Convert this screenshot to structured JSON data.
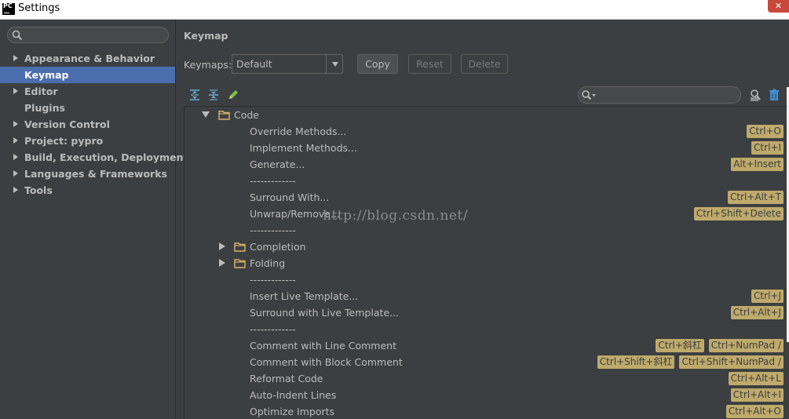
{
  "window": {
    "title": "Settings",
    "app_icon_text": "PC",
    "close_glyph": "✕"
  },
  "sidebar": {
    "search": {
      "placeholder": "",
      "value": ""
    },
    "items": [
      {
        "label": "Appearance & Behavior",
        "expandable": true
      },
      {
        "label": "Keymap",
        "expandable": false,
        "selected": true
      },
      {
        "label": "Editor",
        "expandable": true
      },
      {
        "label": "Plugins",
        "expandable": false
      },
      {
        "label": "Version Control",
        "expandable": true
      },
      {
        "label": "Project: pypro",
        "expandable": true
      },
      {
        "label": "Build, Execution, Deployment",
        "expandable": true
      },
      {
        "label": "Languages & Frameworks",
        "expandable": true
      },
      {
        "label": "Tools",
        "expandable": true
      }
    ]
  },
  "main": {
    "title": "Keymap",
    "keymaps_label": "Keymaps:",
    "keymap_selected": "Default",
    "buttons": {
      "copy": "Copy",
      "reset": "Reset",
      "delete": "Delete"
    },
    "toolbar_icons": [
      "expand-all-icon",
      "collapse-all-icon",
      "edit-icon"
    ],
    "filter": {
      "placeholder": "",
      "value": ""
    },
    "right_icons": [
      "find-by-shortcut-icon",
      "clear-filter-icon"
    ]
  },
  "tree": {
    "root": {
      "label": "Code",
      "expanded": true
    },
    "rows": [
      {
        "label": "Override Methods...",
        "shortcuts": [
          "Ctrl+O"
        ]
      },
      {
        "label": "Implement Methods...",
        "shortcuts": [
          "Ctrl+I"
        ]
      },
      {
        "label": "Generate...",
        "shortcuts": [
          "Alt+Insert"
        ]
      },
      {
        "label": "-------------",
        "shortcuts": []
      },
      {
        "label": "Surround With...",
        "shortcuts": [
          "Ctrl+Alt+T"
        ]
      },
      {
        "label": "Unwrap/Remove...",
        "shortcuts": [
          "Ctrl+Shift+Delete"
        ]
      },
      {
        "label": "-------------",
        "shortcuts": []
      },
      {
        "label": "Completion",
        "shortcuts": [],
        "folder": true
      },
      {
        "label": "Folding",
        "shortcuts": [],
        "folder": true
      },
      {
        "label": "-------------",
        "shortcuts": []
      },
      {
        "label": "Insert Live Template...",
        "shortcuts": [
          "Ctrl+J"
        ]
      },
      {
        "label": "Surround with Live Template...",
        "shortcuts": [
          "Ctrl+Alt+J"
        ]
      },
      {
        "label": "-------------",
        "shortcuts": []
      },
      {
        "label": "Comment with Line Comment",
        "shortcuts": [
          "Ctrl+斜杠",
          "Ctrl+NumPad /"
        ]
      },
      {
        "label": "Comment with Block Comment",
        "shortcuts": [
          "Ctrl+Shift+斜杠",
          "Ctrl+Shift+NumPad /"
        ]
      },
      {
        "label": "Reformat Code",
        "shortcuts": [
          "Ctrl+Alt+L"
        ]
      },
      {
        "label": "Auto-Indent Lines",
        "shortcuts": [
          "Ctrl+Alt+I"
        ]
      },
      {
        "label": "Optimize Imports",
        "shortcuts": [
          "Ctrl+Alt+O"
        ]
      }
    ]
  },
  "watermark": "http://blog.csdn.net/",
  "colors": {
    "background": "#3c3f41",
    "selection": "#4b6eaf",
    "shortcut_badge": "#bfaa6b",
    "folder": "#d6b36a"
  }
}
